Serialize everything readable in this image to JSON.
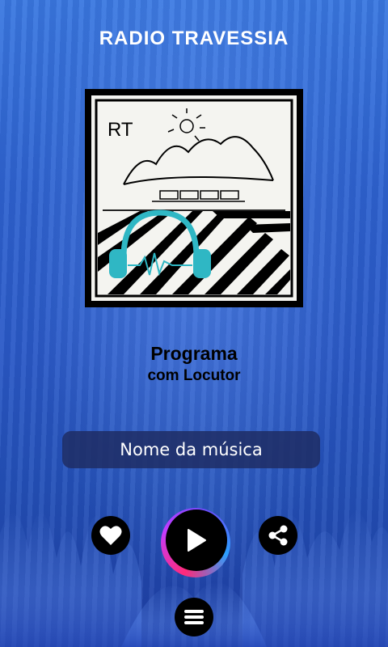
{
  "header": {
    "title": "RADIO TRAVESSIA"
  },
  "cover": {
    "logo_text": "RT"
  },
  "now_playing": {
    "program": "Programa",
    "host": "com Locutor",
    "song": "Nome da música"
  },
  "controls": {
    "like_icon": "heart-icon",
    "play_icon": "play-icon",
    "share_icon": "share-icon",
    "menu_icon": "menu-icon"
  },
  "colors": {
    "background": "#2a59c6",
    "song_box": "#1e2d64",
    "accent_ring": "#ff2a7a"
  }
}
